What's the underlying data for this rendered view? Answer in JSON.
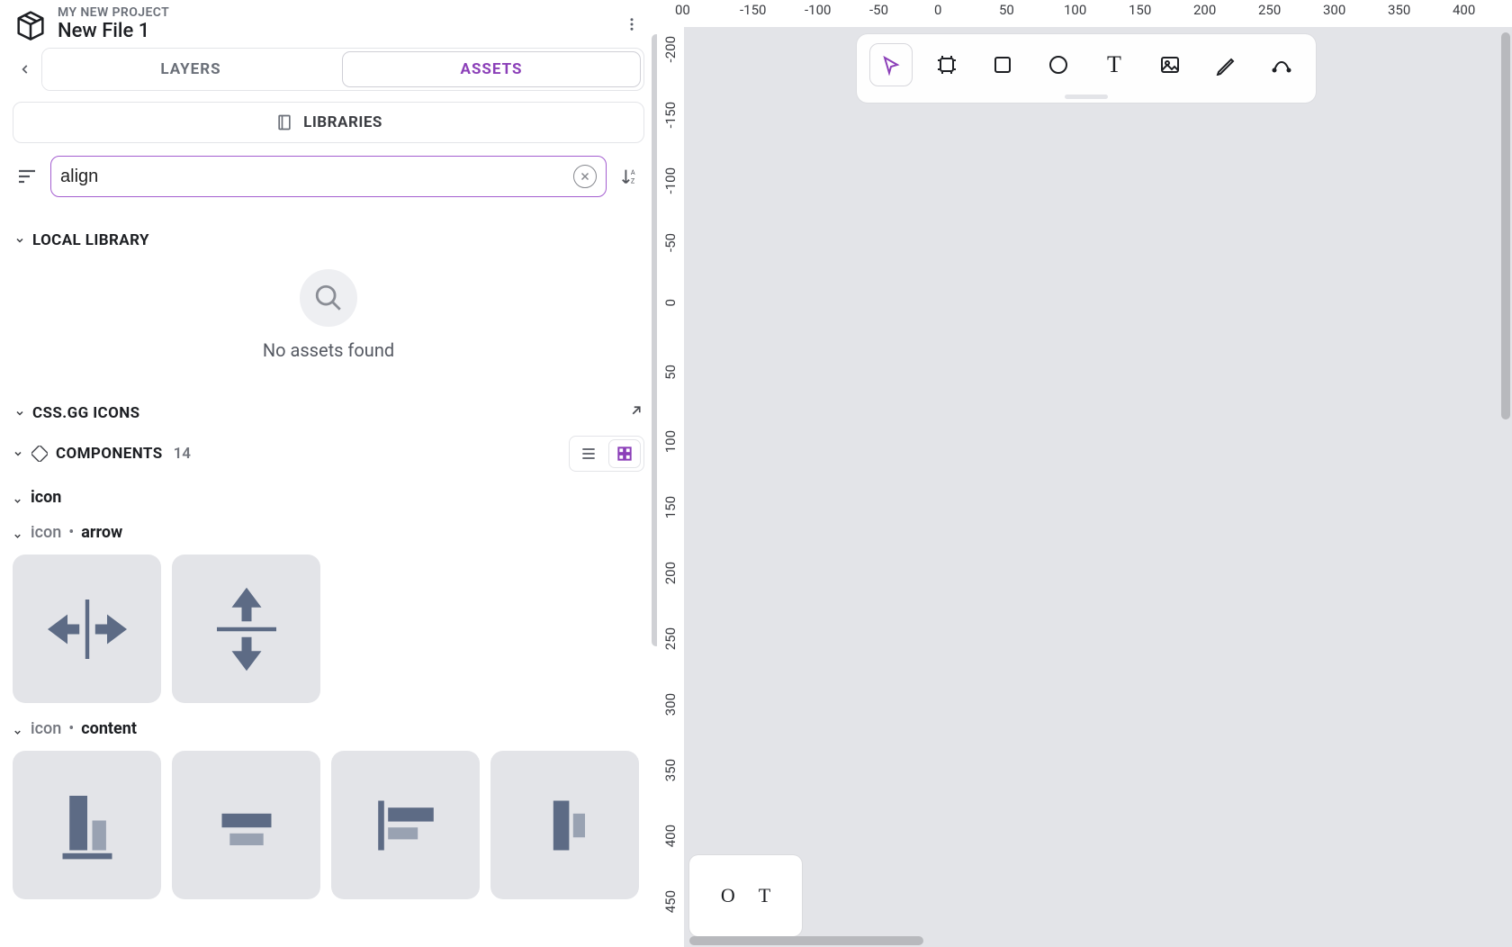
{
  "header": {
    "project_name": "MY NEW PROJECT",
    "file_name": "New File 1"
  },
  "tabs": {
    "layers": "LAYERS",
    "assets": "ASSETS",
    "active": "assets"
  },
  "libraries_button": "LIBRARIES",
  "search": {
    "value": "align"
  },
  "local_library": {
    "title": "LOCAL LIBRARY",
    "empty_text": "No assets found"
  },
  "cssgg": {
    "title": "CSS.GG ICONS"
  },
  "components": {
    "label": "COMPONENTS",
    "count": "14",
    "view": "grid"
  },
  "group_icon": {
    "label": "icon"
  },
  "group_icon_arrow": {
    "prefix": "icon",
    "name": "arrow",
    "items": [
      "arrows-h-icon",
      "arrows-v-icon"
    ]
  },
  "group_icon_content": {
    "prefix": "icon",
    "name": "content",
    "items": [
      "align-bottom-icon",
      "align-center-icon",
      "align-left-icon",
      "align-middle-icon"
    ]
  },
  "h_ruler": [
    "00",
    "-150",
    "-100",
    "-50",
    "0",
    "50",
    "100",
    "150",
    "200",
    "250",
    "300",
    "350",
    "400"
  ],
  "v_ruler": [
    "-200",
    "-150",
    "-100",
    "-50",
    "0",
    "50",
    "100",
    "150",
    "200",
    "250",
    "300",
    "350",
    "400",
    "450"
  ],
  "mini_panel": {
    "left": "O",
    "right": "T"
  }
}
